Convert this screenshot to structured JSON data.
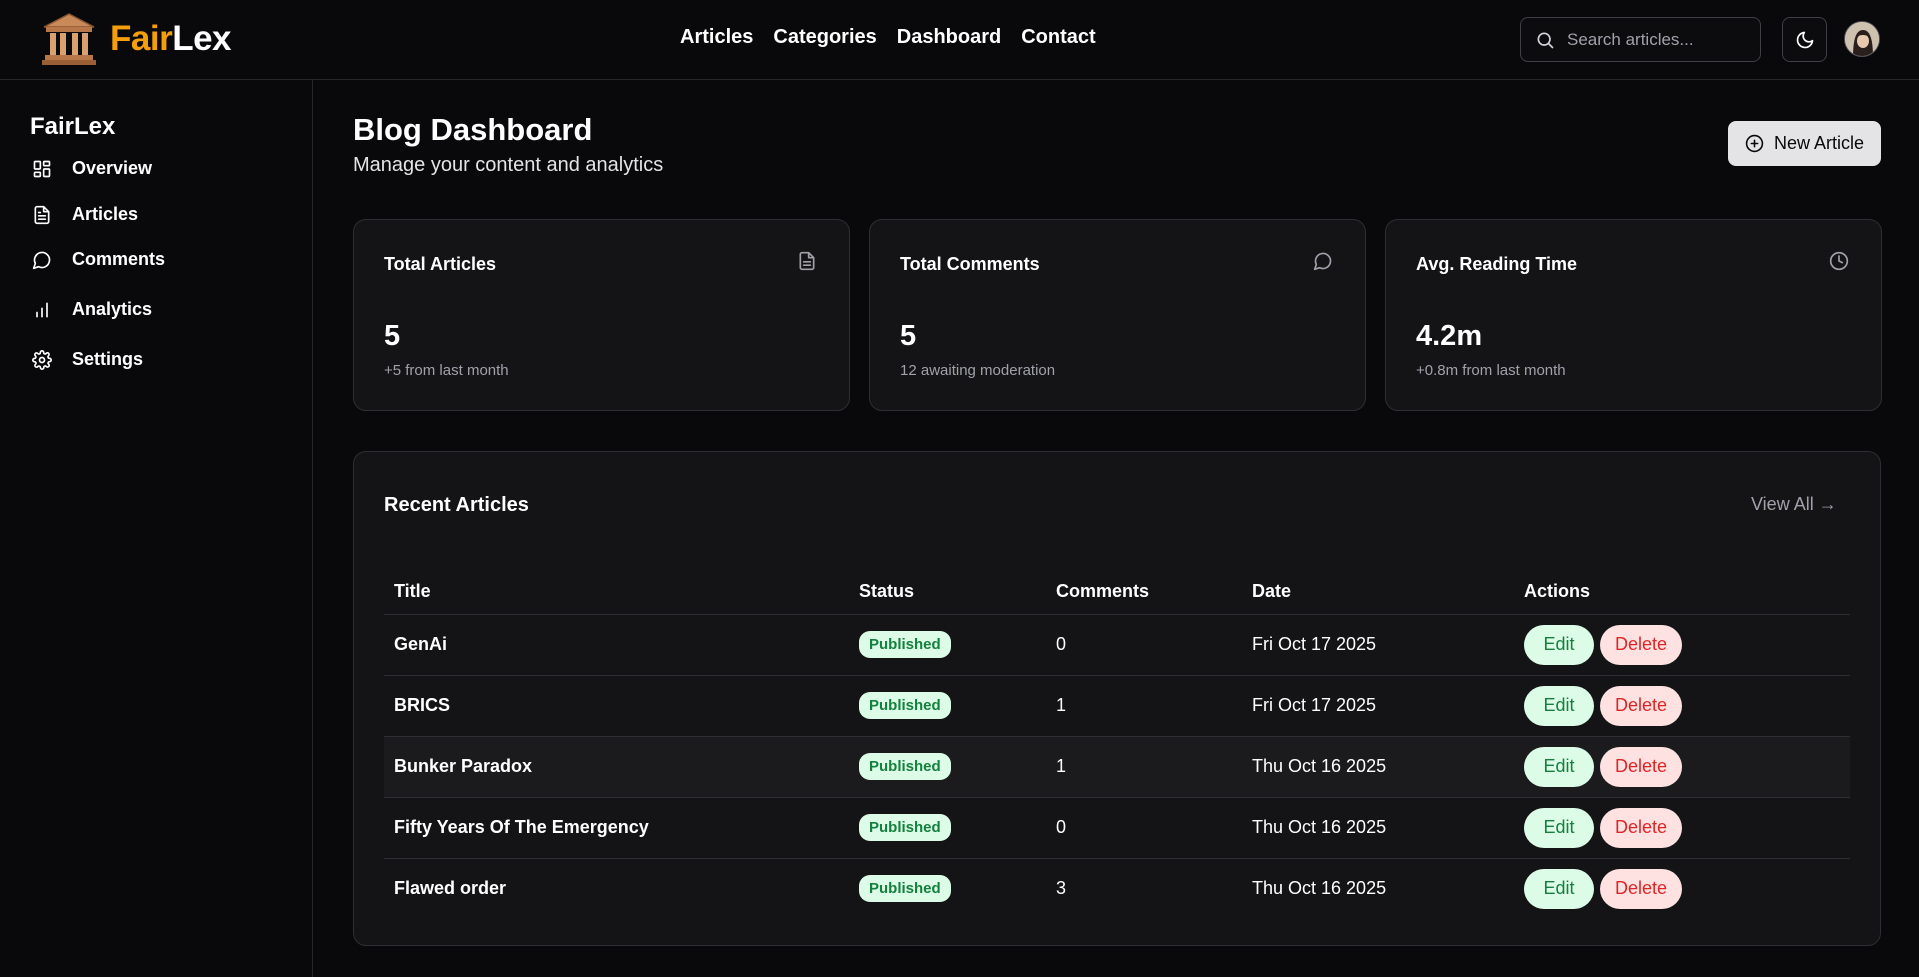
{
  "brand": {
    "name_part1": "Fair",
    "name_part2": "Lex",
    "logo_icon": "courthouse-icon"
  },
  "topnav": {
    "items": [
      "Articles",
      "Categories",
      "Dashboard",
      "Contact"
    ]
  },
  "search": {
    "placeholder": "Search articles...",
    "value": ""
  },
  "theme_toggle": {
    "icon": "moon-icon"
  },
  "sidebar": {
    "title": "FairLex",
    "items": [
      {
        "label": "Overview",
        "icon": "grid-icon"
      },
      {
        "label": "Articles",
        "icon": "file-icon"
      },
      {
        "label": "Comments",
        "icon": "message-circle-icon"
      },
      {
        "label": "Analytics",
        "icon": "bar-chart-icon"
      },
      {
        "label": "Settings",
        "icon": "gear-icon"
      }
    ]
  },
  "header": {
    "title": "Blog Dashboard",
    "subtitle": "Manage your content and analytics",
    "new_article_label": "New Article"
  },
  "stats": [
    {
      "title": "Total Articles",
      "value": "5",
      "note": "+5 from last month",
      "icon": "file-text-icon"
    },
    {
      "title": "Total Comments",
      "value": "5",
      "note": "12 awaiting moderation",
      "icon": "message-circle-icon"
    },
    {
      "title": "Avg. Reading Time",
      "value": "4.2m",
      "note": "+0.8m from last month",
      "icon": "clock-icon"
    }
  ],
  "recent": {
    "title": "Recent Articles",
    "view_all": "View All →",
    "columns": [
      "Title",
      "Status",
      "Comments",
      "Date",
      "Actions"
    ],
    "edit_label": "Edit",
    "delete_label": "Delete",
    "rows": [
      {
        "title": "GenAi",
        "status": "Published",
        "comments": "0",
        "date": "Fri Oct 17 2025"
      },
      {
        "title": "BRICS",
        "status": "Published",
        "comments": "1",
        "date": "Fri Oct 17 2025"
      },
      {
        "title": "Bunker Paradox",
        "status": "Published",
        "comments": "1",
        "date": "Thu Oct 16 2025"
      },
      {
        "title": "Fifty Years Of The Emergency",
        "status": "Published",
        "comments": "0",
        "date": "Thu Oct 16 2025"
      },
      {
        "title": "Flawed order",
        "status": "Published",
        "comments": "3",
        "date": "Thu Oct 16 2025"
      }
    ]
  },
  "colors": {
    "background": "#09090b",
    "brand_accent": "#f59e0b",
    "published_badge_bg": "#dcfce7",
    "published_badge_text": "#15803d",
    "delete_bg": "#fee2e2",
    "delete_text": "#dc2626"
  }
}
